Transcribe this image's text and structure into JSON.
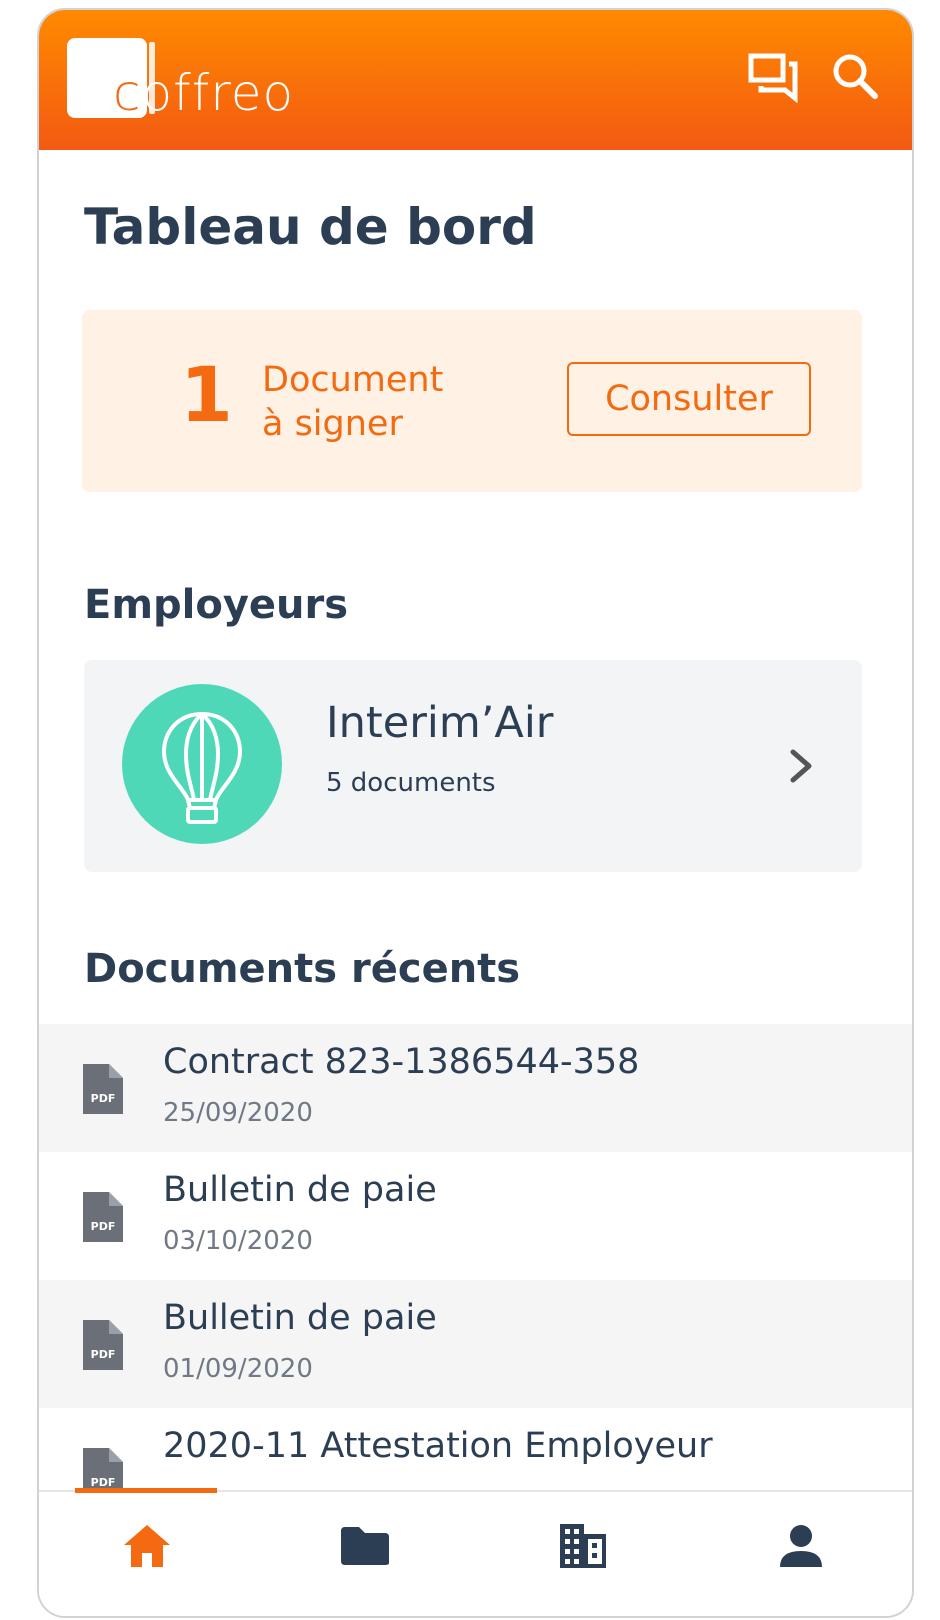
{
  "header": {
    "logo_first_letter": "c",
    "logo_rest": "offreo",
    "brand_color": "#f36a10",
    "icons": [
      "chat-icon",
      "search-icon"
    ]
  },
  "dashboard": {
    "title": "Tableau de bord"
  },
  "signature_card": {
    "count": "1",
    "label_line1": "Document",
    "label_line2": "à signer",
    "button_label": "Consulter"
  },
  "employers": {
    "section_title": "Employeurs",
    "items": [
      {
        "name": "Interim’Air",
        "docs": "5 documents",
        "icon": "hot-air-balloon-icon",
        "avatar_color": "#4fd8b8"
      }
    ]
  },
  "recent_documents": {
    "section_title": "Documents récents",
    "items": [
      {
        "title": "Contract 823-1386544-358",
        "date": "25/09/2020",
        "type": "PDF"
      },
      {
        "title": "Bulletin de paie",
        "date": "03/10/2020",
        "type": "PDF"
      },
      {
        "title": "Bulletin de paie",
        "date": "01/09/2020",
        "type": "PDF"
      },
      {
        "title": "2020-11 Attestation Employeur",
        "date": "",
        "type": "PDF"
      }
    ]
  },
  "tabbar": {
    "tabs": [
      {
        "icon": "home-icon",
        "active": true
      },
      {
        "icon": "folder-icon",
        "active": false
      },
      {
        "icon": "building-icon",
        "active": false
      },
      {
        "icon": "user-icon",
        "active": false
      }
    ]
  }
}
